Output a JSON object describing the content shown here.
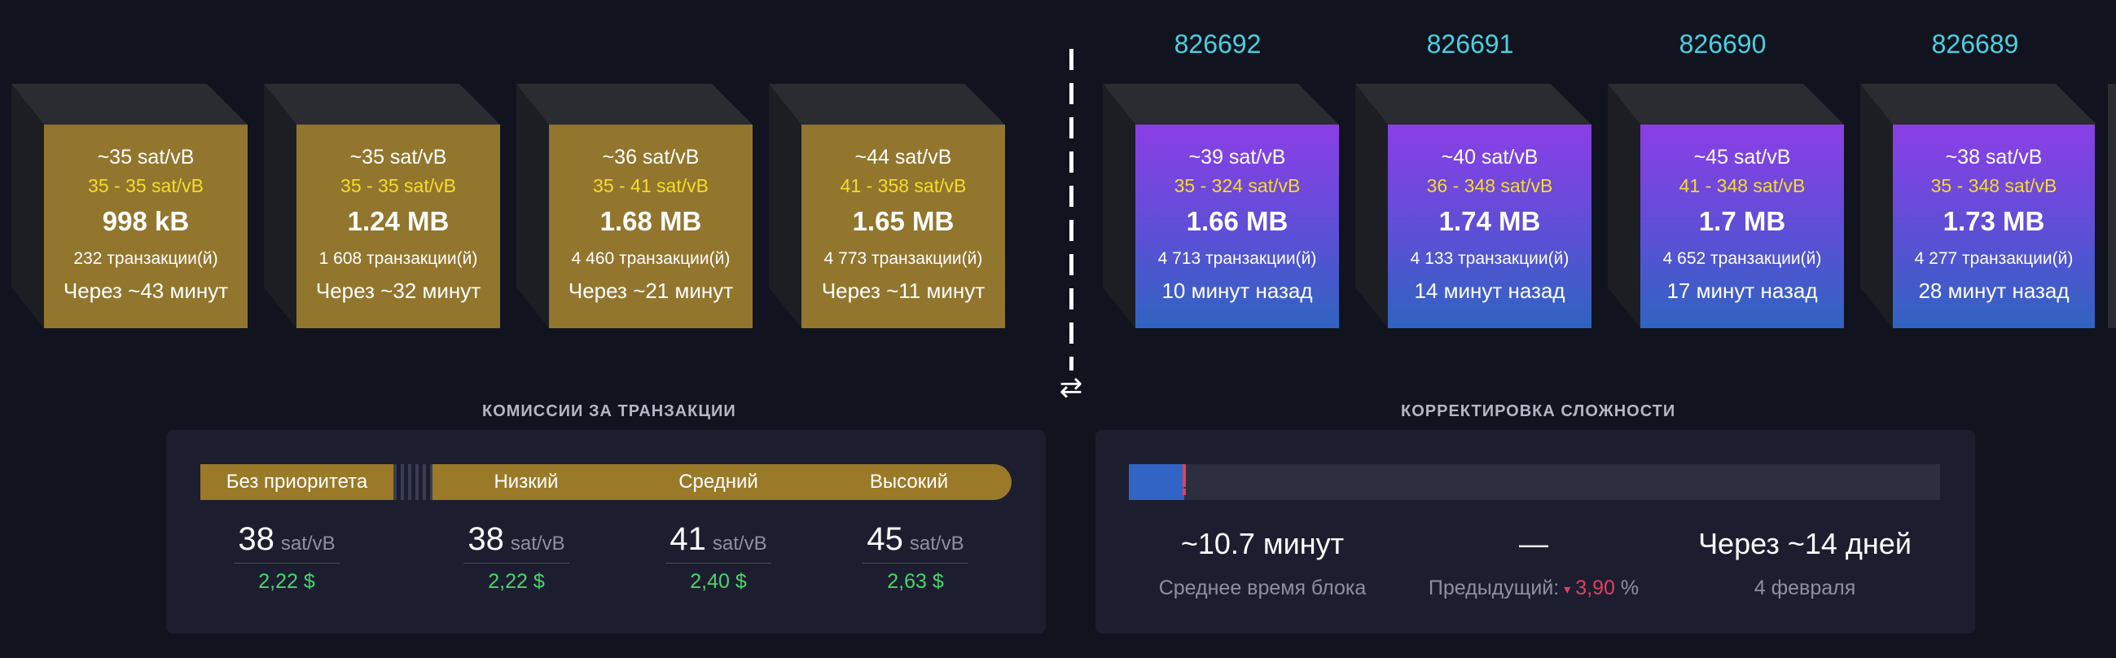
{
  "mempool_blocks": [
    {
      "fee_median": "~35 sat/vB",
      "fee_range": "35 - 35 sat/vB",
      "size": "998 kB",
      "txs": "232 транзакции(й)",
      "time": "Через ~43 минут"
    },
    {
      "fee_median": "~35 sat/vB",
      "fee_range": "35 - 35 sat/vB",
      "size": "1.24 MB",
      "txs": "1 608 транзакции(й)",
      "time": "Через ~32 минут"
    },
    {
      "fee_median": "~36 sat/vB",
      "fee_range": "35 - 41 sat/vB",
      "size": "1.68 MB",
      "txs": "4 460 транзакции(й)",
      "time": "Через ~21 минут"
    },
    {
      "fee_median": "~44 sat/vB",
      "fee_range": "41 - 358 sat/vB",
      "size": "1.65 MB",
      "txs": "4 773 транзакции(й)",
      "time": "Через ~11 минут"
    }
  ],
  "mined_blocks": [
    {
      "height": "826692",
      "fee_median": "~39 sat/vB",
      "fee_range": "35 - 324 sat/vB",
      "size": "1.66 MB",
      "txs": "4 713 транзакции(й)",
      "time": "10 минут назад"
    },
    {
      "height": "826691",
      "fee_median": "~40 sat/vB",
      "fee_range": "36 - 348 sat/vB",
      "size": "1.74 MB",
      "txs": "4 133 транзакции(й)",
      "time": "14 минут назад"
    },
    {
      "height": "826690",
      "fee_median": "~45 sat/vB",
      "fee_range": "41 - 348 sat/vB",
      "size": "1.7 MB",
      "txs": "4 652 транзакции(й)",
      "time": "17 минут назад"
    },
    {
      "height": "826689",
      "fee_median": "~38 sat/vB",
      "fee_range": "35 - 348 sat/vB",
      "size": "1.73 MB",
      "txs": "4 277 транзакции(й)",
      "time": "28 минут назад"
    }
  ],
  "swap_icon": "⇄",
  "fees": {
    "title": "КОМИССИИ ЗА ТРАНЗАКЦИИ",
    "labels": {
      "none": "Без приоритета",
      "low": "Низкий",
      "medium": "Средний",
      "high": "Высокий"
    },
    "columns": [
      {
        "value": "38",
        "unit": "sat/vB",
        "usd": "2,22 $"
      },
      {
        "value": "38",
        "unit": "sat/vB",
        "usd": "2,22 $"
      },
      {
        "value": "41",
        "unit": "sat/vB",
        "usd": "2,40 $"
      },
      {
        "value": "45",
        "unit": "sat/vB",
        "usd": "2,63 $"
      }
    ],
    "colors": {
      "bar": "#9a7a28",
      "usd": "#4cd36b"
    }
  },
  "difficulty": {
    "title": "КОРРЕКТИРОВКА СЛОЖНОСТИ",
    "progress_fraction": 0.068,
    "marker_fraction": 0.068,
    "avg_block_time": "~10.7 минут",
    "avg_block_time_label": "Среднее время блока",
    "change": "—",
    "previous_label": "Предыдущий:",
    "previous_arrow": "▾",
    "previous_value": "3,90",
    "previous_unit": "%",
    "eta": "Через ~14 дней",
    "eta_date": "4 февраля",
    "colors": {
      "fill": "#3164c4",
      "marker": "#e4405a",
      "negative": "#e4405a"
    }
  }
}
